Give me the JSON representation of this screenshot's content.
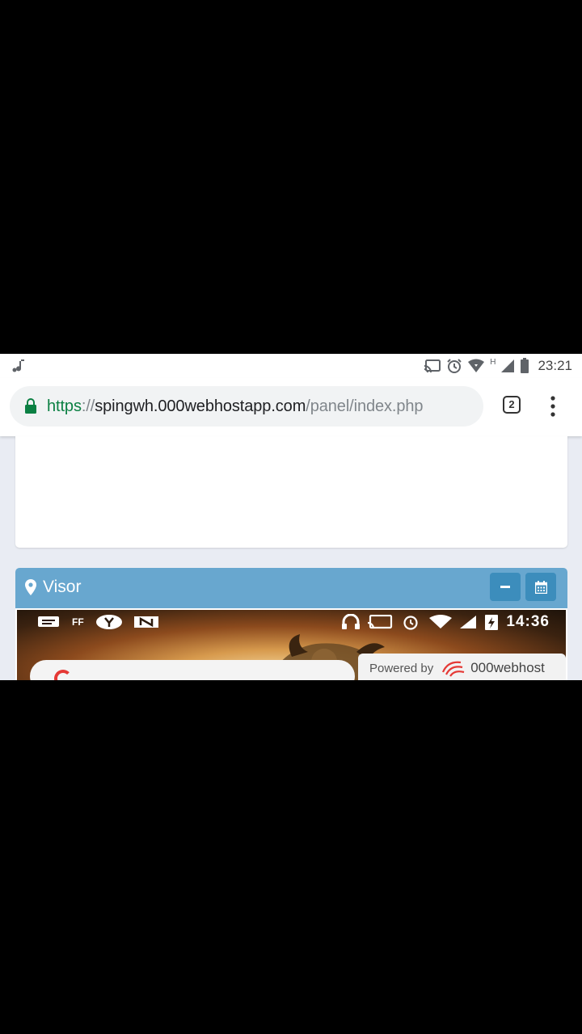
{
  "status_bar": {
    "time": "23:21",
    "network_label": "H",
    "icons": [
      "music-note-icon",
      "cast-icon",
      "alarm-icon",
      "wifi-icon",
      "cell-signal-icon",
      "battery-icon"
    ]
  },
  "browser": {
    "url_scheme": "https",
    "url_separator": "://",
    "url_host": "spingwh.000webhostapp.com",
    "url_path": "/panel/index.php",
    "tab_count": "2",
    "secure_color": "#0b8043"
  },
  "panel": {
    "title": "Visor",
    "header_color": "#68a7cf",
    "button_color": "#3c8dbc",
    "icons": [
      "map-marker-icon",
      "minus-icon",
      "calendar-icon"
    ]
  },
  "viewer": {
    "inner_time": "14:36",
    "inner_labels": [
      "FF"
    ],
    "powered_by": "Powered by",
    "brand": "000webhost"
  }
}
